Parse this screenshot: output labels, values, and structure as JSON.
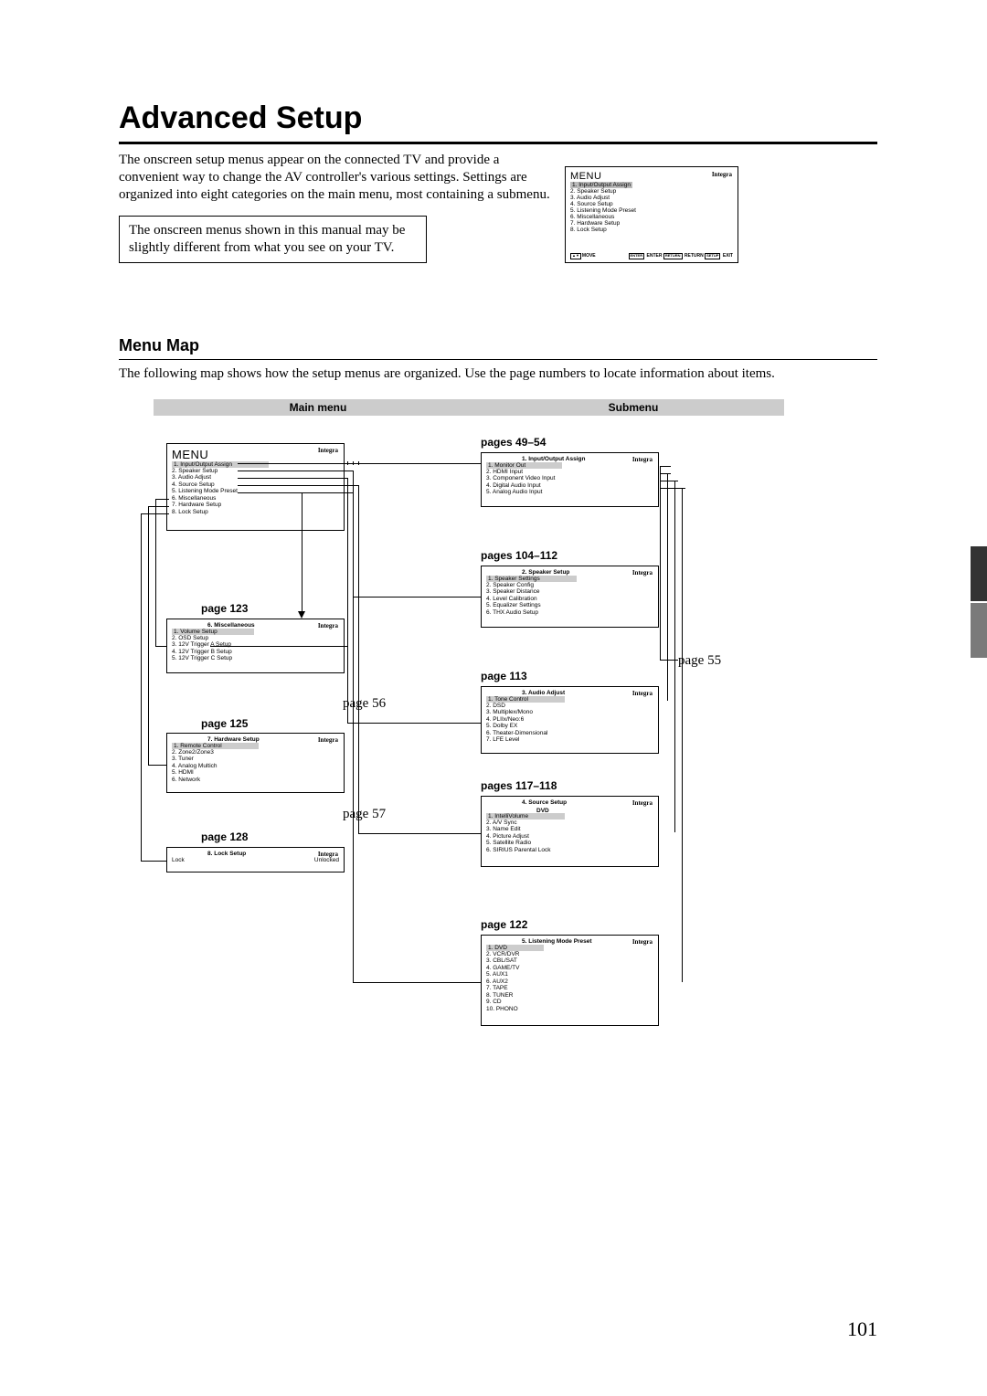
{
  "title": "Advanced Setup",
  "intro": "The onscreen setup menus appear on the connected TV and provide a convenient way to change the AV controller's various settings. Settings are organized into eight categories on the main menu, most containing a submenu.",
  "note": "The onscreen menus shown in this manual may be slightly different from what you see on your TV.",
  "section_heading": "Menu Map",
  "section_text": "The following map shows how the setup menus are organized. Use the page numbers to locate information about items.",
  "column_headers": {
    "main": "Main menu",
    "sub": "Submenu"
  },
  "brand": "Integra",
  "ref_menu": {
    "title": "MENU",
    "items": [
      "1. Input/Output Assign",
      "2. Speaker Setup",
      "3. Audio Adjust",
      "4. Source Setup",
      "5. Listening Mode Preset",
      "6. Miscellaneous",
      "7. Hardware Setup",
      "8. Lock Setup"
    ],
    "highlight_index": 0,
    "footer_left": "MOVE",
    "footer_right": "ENTER            RETURN           EXIT"
  },
  "main_cards": {
    "main_menu": {
      "title": "MENU",
      "items": [
        "1. Input/Output Assign",
        "2. Speaker Setup",
        "3. Audio Adjust",
        "4. Source Setup",
        "5. Listening Mode Preset",
        "6. Miscellaneous",
        "7. Hardware Setup",
        "8. Lock Setup"
      ],
      "highlight_index": 0
    },
    "misc": {
      "page_label": "page 123",
      "header": "6.    Miscellaneous",
      "items": [
        "1.   Volume Setup",
        "2.   OSD Setup",
        "3.   12V Trigger A Setup",
        "4.   12V Trigger B Setup",
        "5.   12V Trigger C Setup"
      ],
      "highlight_index": 0,
      "ext_page": "page 56"
    },
    "hardware": {
      "page_label": "page 125",
      "header": "7.    Hardware Setup",
      "items": [
        "1.   Remote Control",
        "2.   Zone2/Zone3",
        "3.   Tuner",
        "4.   Analog Multich",
        "5.   HDMI",
        "6.   Network"
      ],
      "highlight_index": 0,
      "ext_page": "page 57"
    },
    "lock": {
      "page_label": "page 128",
      "header": "8.    Lock Setup",
      "row_label": "Lock",
      "row_value": "Unlocked"
    }
  },
  "sub_cards": {
    "io": {
      "page_label": "pages 49–54",
      "header": "1.    Input/Output Assign",
      "items": [
        "1.   Monitor Out",
        "2.   HDMI Input",
        "3.   Component Video Input",
        "4.   Digital Audio Input",
        "5.   Analog Audio Input"
      ],
      "highlight_index": 0
    },
    "speaker": {
      "page_label": "pages 104–112",
      "header": "2.    Speaker Setup",
      "items": [
        "1.   Speaker Settings",
        "2.   Speaker Config",
        "3.   Speaker Distance",
        "4.   Level Calibration",
        "5.   Equalizer Settings",
        "6.   THX Audio Setup"
      ],
      "highlight_index": 0,
      "ext_page": "page 55"
    },
    "audio": {
      "page_label": "page 113",
      "header": "3.    Audio Adjust",
      "items": [
        "1.   Tone Control",
        "2.   DSD",
        "3.   Multiplex/Mono",
        "4.   PLIIx/Neo:6",
        "5.   Dolby EX",
        "6.   Theater-Dimensional",
        "7.   LFE Level"
      ],
      "highlight_index": 0
    },
    "source": {
      "page_label": "pages 117–118",
      "header": "4.    Source Setup",
      "dvd": "DVD",
      "items": [
        "1.   IntelliVolume",
        "2.   A/V Sync",
        "3.   Name Edit",
        "4.   Picture Adjust",
        "5.   Satellite Radio",
        "6.   SIRIUS Parental Lock"
      ],
      "highlight_index": 0
    },
    "listening": {
      "page_label": "page 122",
      "header": "5.    Listening Mode Preset",
      "items": [
        "1.   DVD",
        "2.   VCR/DVR",
        "3.   CBL/SAT",
        "4.   GAME/TV",
        "5.   AUX1",
        "6.   AUX2",
        "7.   TAPE",
        "8.   TUNER",
        "9.   CD",
        "10. PHONO"
      ],
      "highlight_index": 0
    }
  },
  "page_number": "101"
}
